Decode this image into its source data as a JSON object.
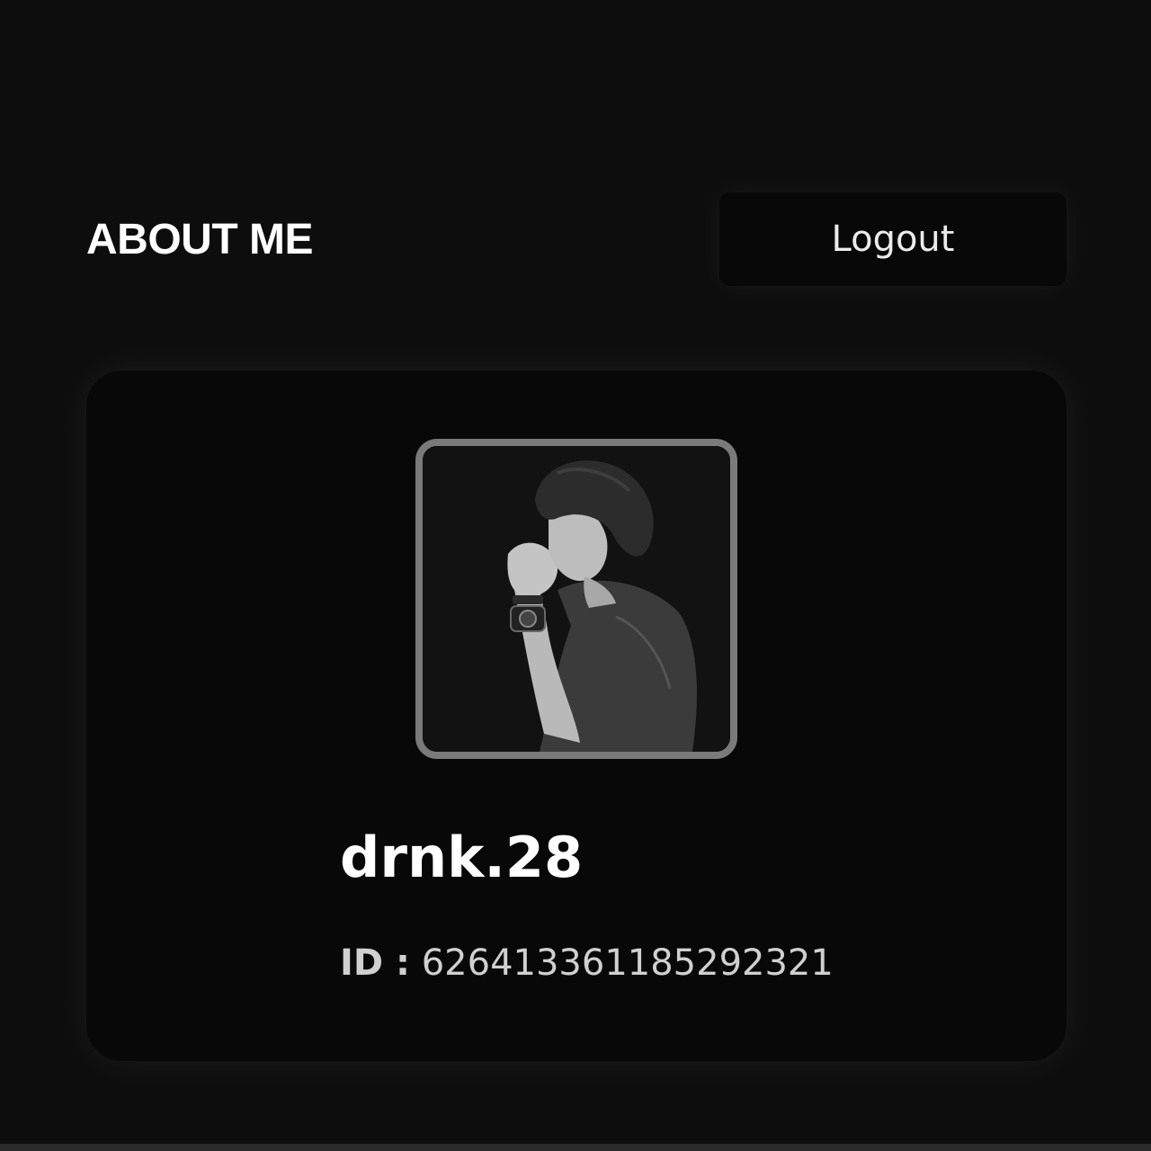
{
  "header": {
    "title": "ABOUT ME",
    "logout_label": "Logout"
  },
  "profile": {
    "username": "drnk.28",
    "id_label": "ID :",
    "id_value": "626413361185292321"
  },
  "colors": {
    "background": "#0d0d0d",
    "card": "#080808",
    "avatar_border": "#7a7a7a",
    "text_primary": "#ffffff",
    "text_secondary": "#d0d0d0"
  }
}
